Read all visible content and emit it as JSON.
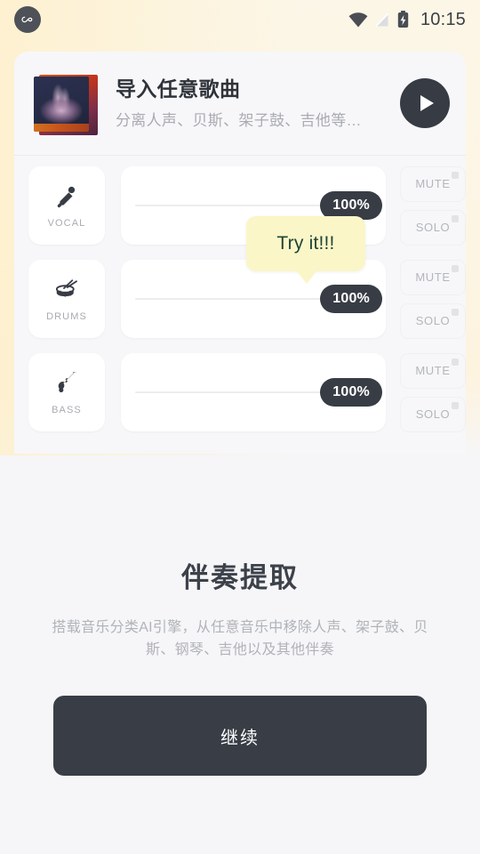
{
  "status_bar": {
    "app_icon": "infinity-app-icon",
    "wifi_icon": "wifi-icon",
    "signal_icon": "cellular-signal-off-icon",
    "battery_icon": "battery-charging-icon",
    "time": "10:15"
  },
  "song_header": {
    "album_art": "album-art-thumbnail",
    "title": "导入任意歌曲",
    "subtitle": "分离人声、贝斯、架子鼓、吉他等…",
    "play_icon": "play-icon"
  },
  "tracks": [
    {
      "id": "vocal",
      "icon": "microphone-icon",
      "label": "VOCAL",
      "volume": "100%",
      "mute_label": "MUTE",
      "solo_label": "SOLO"
    },
    {
      "id": "drums",
      "icon": "drums-icon",
      "label": "DRUMS",
      "volume": "100%",
      "mute_label": "MUTE",
      "solo_label": "SOLO"
    },
    {
      "id": "bass",
      "icon": "bass-guitar-icon",
      "label": "BASS",
      "volume": "100%",
      "mute_label": "MUTE",
      "solo_label": "SOLO"
    }
  ],
  "tooltip": {
    "text": "Try it!!!"
  },
  "promo": {
    "title": "伴奏提取",
    "description": "搭载音乐分类AI引擎，从任意音乐中移除人声、架子鼓、贝斯、钢琴、吉他以及其他伴奏",
    "cta_label": "继续"
  },
  "colors": {
    "accent_dark": "#373c45",
    "tooltip_bg": "#faf6c8",
    "tooltip_text": "#1f4434",
    "page_bg": "#f6f6f8",
    "panel_bg": "#f7f7f9",
    "warm_bg": "#fdf5e3"
  }
}
